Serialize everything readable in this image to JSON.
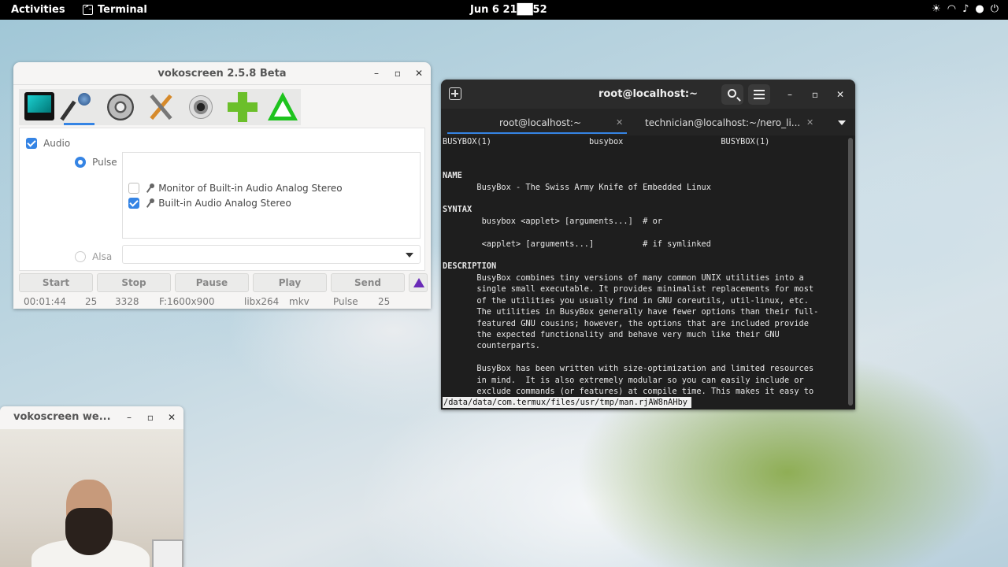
{
  "topbar": {
    "activities": "Activities",
    "app_name": "Terminal",
    "clock": "Jun 6  21██52",
    "tray_icons": [
      "brightness-icon",
      "wifi-icon",
      "volume-icon",
      "mic-icon",
      "power-icon"
    ]
  },
  "voko": {
    "title": "vokoscreen 2.5.8 Beta",
    "tools": [
      "screen-icon",
      "audio-icon",
      "video-icon",
      "settings-icon",
      "webcam-icon",
      "add-icon",
      "about-icon"
    ],
    "audio_label": "Audio",
    "pulse_label": "Pulse",
    "devices": [
      {
        "label": "Monitor of Built-in Audio Analog Stereo",
        "checked": false
      },
      {
        "label": "Built-in Audio Analog Stereo",
        "checked": true
      }
    ],
    "alsa_label": "Alsa",
    "buttons": {
      "start": "Start",
      "stop": "Stop",
      "pause": "Pause",
      "play": "Play",
      "send": "Send"
    },
    "status": {
      "time": "00:01:44",
      "fps": "25",
      "frames": "3328",
      "format": "F:1600x900",
      "codec": "libx264",
      "container": "mkv",
      "audio": "Pulse",
      "fps2": "25"
    }
  },
  "terminal": {
    "title": "root@localhost:~",
    "tabs": [
      {
        "label": "root@localhost:~",
        "active": true
      },
      {
        "label": "technician@localhost:~/nero_li...",
        "active": false
      }
    ],
    "lines": [
      "BUSYBOX(1)                    busybox                    BUSYBOX(1)",
      "",
      "",
      "NAME",
      "       BusyBox - The Swiss Army Knife of Embedded Linux",
      "",
      "SYNTAX",
      "        busybox <applet> [arguments...]  # or",
      "",
      "        <applet> [arguments...]          # if symlinked",
      "",
      "DESCRIPTION",
      "       BusyBox combines tiny versions of many common UNIX utilities into a",
      "       single small executable. It provides minimalist replacements for most",
      "       of the utilities you usually find in GNU coreutils, util-linux, etc.",
      "       The utilities in BusyBox generally have fewer options than their full-",
      "       featured GNU cousins; however, the options that are included provide",
      "       the expected functionality and behave very much like their GNU",
      "       counterparts.",
      "",
      "       BusyBox has been written with size-optimization and limited resources",
      "       in mind.  It is also extremely modular so you can easily include or",
      "       exclude commands (or features) at compile time. This makes it easy to"
    ],
    "bold_lines": [
      "NAME",
      "SYNTAX",
      "DESCRIPTION"
    ],
    "status_line": "/data/data/com.termux/files/usr/tmp/man.rjAW8nAHby"
  },
  "webcam": {
    "title": "vokoscreen we..."
  },
  "colors": {
    "accent": "#3584e4",
    "terminal_bg": "#1e1e1e",
    "topbar_bg": "#000000"
  }
}
